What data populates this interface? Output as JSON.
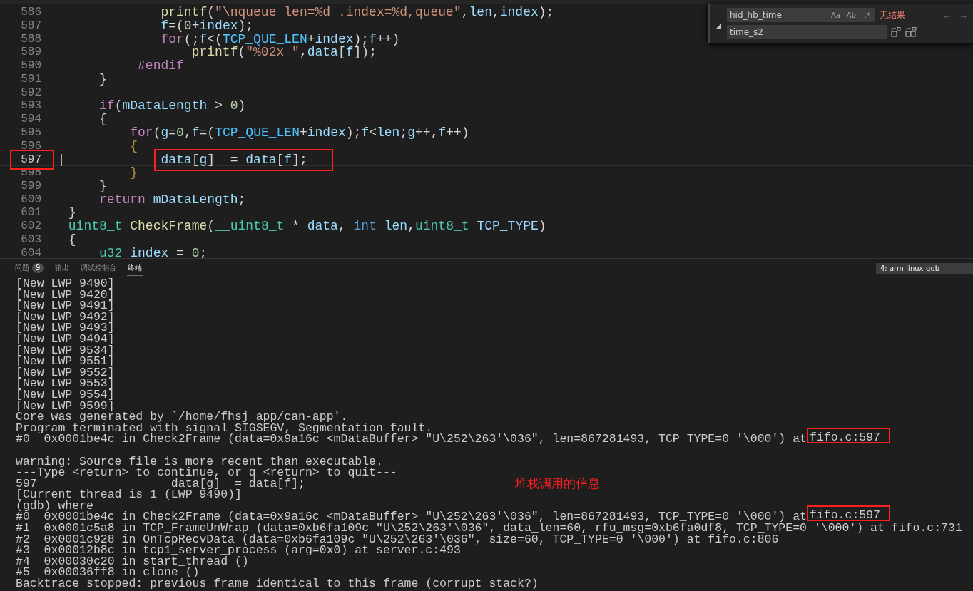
{
  "editor": {
    "lines": [
      {
        "number": "586",
        "tokens": [
          {
            "kind": "function",
            "text": "            printf"
          },
          {
            "kind": "plain",
            "text": "("
          },
          {
            "kind": "string",
            "text": "\"\\nqueue len=%d .index=%d,queue\""
          },
          {
            "kind": "plain",
            "text": ","
          },
          {
            "kind": "variable",
            "text": "len"
          },
          {
            "kind": "plain",
            "text": ","
          },
          {
            "kind": "variable",
            "text": "index"
          },
          {
            "kind": "plain",
            "text": ");"
          }
        ]
      },
      {
        "number": "587",
        "tokens": [
          {
            "kind": "variable",
            "text": "            f"
          },
          {
            "kind": "plain",
            "text": "=("
          },
          {
            "kind": "number",
            "text": "0"
          },
          {
            "kind": "plain",
            "text": "+"
          },
          {
            "kind": "variable",
            "text": "index"
          },
          {
            "kind": "plain",
            "text": ");"
          }
        ]
      },
      {
        "number": "588",
        "tokens": [
          {
            "kind": "keyword",
            "text": "            for"
          },
          {
            "kind": "plain",
            "text": "(;"
          },
          {
            "kind": "variable",
            "text": "f"
          },
          {
            "kind": "plain",
            "text": "<("
          },
          {
            "kind": "macro",
            "text": "TCP_QUE_LEN"
          },
          {
            "kind": "plain",
            "text": "+"
          },
          {
            "kind": "variable",
            "text": "index"
          },
          {
            "kind": "plain",
            "text": ");"
          },
          {
            "kind": "variable",
            "text": "f"
          },
          {
            "kind": "plain",
            "text": "++)"
          }
        ]
      },
      {
        "number": "589",
        "tokens": [
          {
            "kind": "function",
            "text": "                printf"
          },
          {
            "kind": "plain",
            "text": "("
          },
          {
            "kind": "string",
            "text": "\"%02x \""
          },
          {
            "kind": "plain",
            "text": ","
          },
          {
            "kind": "variable",
            "text": "data"
          },
          {
            "kind": "plain",
            "text": "["
          },
          {
            "kind": "variable",
            "text": "f"
          },
          {
            "kind": "plain",
            "text": "]);"
          }
        ]
      },
      {
        "number": "590",
        "tokens": [
          {
            "kind": "preprocessor",
            "text": "         #endif"
          }
        ]
      },
      {
        "number": "591",
        "tokens": [
          {
            "kind": "plain",
            "text": "    }"
          }
        ]
      },
      {
        "number": "592"
      },
      {
        "number": "593",
        "tokens": [
          {
            "kind": "keyword",
            "text": "    if"
          },
          {
            "kind": "plain",
            "text": "("
          },
          {
            "kind": "variable",
            "text": "mDataLength"
          },
          {
            "kind": "plain",
            "text": " > "
          },
          {
            "kind": "number",
            "text": "0"
          },
          {
            "kind": "plain",
            "text": ")"
          }
        ]
      },
      {
        "number": "594",
        "tokens": [
          {
            "kind": "plain",
            "text": "    {"
          }
        ]
      },
      {
        "number": "595",
        "tokens": [
          {
            "kind": "keyword",
            "text": "        for"
          },
          {
            "kind": "plain",
            "text": "("
          },
          {
            "kind": "variable",
            "text": "g"
          },
          {
            "kind": "plain",
            "text": "="
          },
          {
            "kind": "number",
            "text": "0"
          },
          {
            "kind": "plain",
            "text": ","
          },
          {
            "kind": "variable",
            "text": "f"
          },
          {
            "kind": "plain",
            "text": "=("
          },
          {
            "kind": "macro",
            "text": "TCP_QUE_LEN"
          },
          {
            "kind": "plain",
            "text": "+"
          },
          {
            "kind": "variable",
            "text": "index"
          },
          {
            "kind": "plain",
            "text": ");"
          },
          {
            "kind": "variable",
            "text": "f"
          },
          {
            "kind": "plain",
            "text": "<"
          },
          {
            "kind": "variable",
            "text": "len"
          },
          {
            "kind": "plain",
            "text": ";"
          },
          {
            "kind": "variable",
            "text": "g"
          },
          {
            "kind": "plain",
            "text": "++,"
          },
          {
            "kind": "variable",
            "text": "f"
          },
          {
            "kind": "plain",
            "text": "++)"
          }
        ]
      },
      {
        "number": "596",
        "tokens": [
          {
            "kind": "bracket",
            "text": "        {"
          }
        ]
      },
      {
        "number": "597",
        "current": true,
        "marked": true,
        "boxed": true,
        "tokens": [
          {
            "kind": "variable",
            "text": "            data"
          },
          {
            "kind": "plain",
            "text": "["
          },
          {
            "kind": "variable",
            "text": "g"
          },
          {
            "kind": "plain",
            "text": "]  = "
          },
          {
            "kind": "variable",
            "text": "data"
          },
          {
            "kind": "plain",
            "text": "["
          },
          {
            "kind": "variable",
            "text": "f"
          },
          {
            "kind": "plain",
            "text": "];"
          }
        ]
      },
      {
        "number": "598",
        "tokens": [
          {
            "kind": "bracket",
            "text": "        }"
          }
        ]
      },
      {
        "number": "599",
        "tokens": [
          {
            "kind": "plain",
            "text": "    }"
          }
        ]
      },
      {
        "number": "600",
        "tokens": [
          {
            "kind": "keyword",
            "text": "    return"
          },
          {
            "kind": "variable",
            "text": " mDataLength"
          },
          {
            "kind": "plain",
            "text": ";"
          }
        ]
      },
      {
        "number": "601",
        "tokens": [
          {
            "kind": "plain",
            "text": "}"
          }
        ]
      },
      {
        "number": "602",
        "tokens": [
          {
            "kind": "type",
            "text": "uint8_t"
          },
          {
            "kind": "function",
            "text": " CheckFrame"
          },
          {
            "kind": "plain",
            "text": "("
          },
          {
            "kind": "type",
            "text": "__uint8_t"
          },
          {
            "kind": "plain",
            "text": " * "
          },
          {
            "kind": "variable",
            "text": "data"
          },
          {
            "kind": "plain",
            "text": ", "
          },
          {
            "kind": "storage",
            "text": "int"
          },
          {
            "kind": "variable",
            "text": " len"
          },
          {
            "kind": "plain",
            "text": ","
          },
          {
            "kind": "type",
            "text": "uint8_t"
          },
          {
            "kind": "variable",
            "text": " TCP_TYPE"
          },
          {
            "kind": "plain",
            "text": ")"
          }
        ]
      },
      {
        "number": "603",
        "tokens": [
          {
            "kind": "plain",
            "text": "{"
          }
        ]
      },
      {
        "number": "604",
        "tokens": [
          {
            "kind": "type",
            "text": "    u32"
          },
          {
            "kind": "variable",
            "text": " index"
          },
          {
            "kind": "plain",
            "text": " = "
          },
          {
            "kind": "number",
            "text": "0"
          },
          {
            "kind": "plain",
            "text": ";"
          }
        ]
      }
    ]
  },
  "find_widget": {
    "expanded": true,
    "find": {
      "value": "hid_hb_time"
    },
    "options": [
      {
        "label": "Aa",
        "on": false
      },
      {
        "label": "Abl",
        "on": false
      },
      {
        "label": ".*",
        "on": false
      }
    ],
    "result": "无结果",
    "nav": [
      {
        "label": "←",
        "disabled": true
      },
      {
        "label": "→",
        "disabled": true
      }
    ],
    "replace": {
      "value": "time_s2"
    }
  },
  "panel": {
    "tabs": [
      {
        "label": "问题",
        "badge": "9",
        "selected": false
      },
      {
        "label": "输出",
        "selected": false
      },
      {
        "label": "调试控制台",
        "selected": false
      },
      {
        "label": "终端",
        "selected": true
      }
    ],
    "terminal_select": "4: arm-linux-gdb"
  },
  "terminal": {
    "lines": [
      {
        "kind": "text",
        "segments": [
          {
            "text": "[New LWP 9490]"
          }
        ]
      },
      {
        "kind": "text",
        "segments": [
          {
            "text": "[New LWP 9420]"
          }
        ]
      },
      {
        "kind": "text",
        "segments": [
          {
            "text": "[New LWP 9491]"
          }
        ]
      },
      {
        "kind": "text",
        "segments": [
          {
            "text": "[New LWP 9492]"
          }
        ]
      },
      {
        "kind": "text",
        "segments": [
          {
            "text": "[New LWP 9493]"
          }
        ]
      },
      {
        "kind": "text",
        "segments": [
          {
            "text": "[New LWP 9494]"
          }
        ]
      },
      {
        "kind": "text",
        "segments": [
          {
            "text": "[New LWP 9534]"
          }
        ]
      },
      {
        "kind": "text",
        "segments": [
          {
            "text": "[New LWP 9551]"
          }
        ]
      },
      {
        "kind": "text",
        "segments": [
          {
            "text": "[New LWP 9552]"
          }
        ]
      },
      {
        "kind": "text",
        "segments": [
          {
            "text": "[New LWP 9553]"
          }
        ]
      },
      {
        "kind": "text",
        "segments": [
          {
            "text": "[New LWP 9554]"
          }
        ]
      },
      {
        "kind": "text",
        "segments": [
          {
            "text": "[New LWP 9599]"
          }
        ]
      },
      {
        "kind": "text",
        "segments": [
          {
            "text": "Core was generated by `/home/fhsj_app/can-app'."
          }
        ]
      },
      {
        "kind": "text",
        "segments": [
          {
            "text": "Program terminated with signal SIGSEGV, Segmentation fault."
          }
        ]
      },
      {
        "kind": "text",
        "segments": [
          {
            "text": "#0  0x0001be4c in Check2Frame (data=0x9a16c <mDataBuffer> \"U\\252\\263'\\036\", len=867281493, TCP_TYPE=0 '\\000') at"
          },
          {
            "text": "fifo.c:597",
            "boxed": true
          }
        ]
      },
      {
        "kind": "blank"
      },
      {
        "kind": "text",
        "segments": [
          {
            "text": "warning: Source file is more recent than executable."
          }
        ]
      },
      {
        "kind": "text",
        "segments": [
          {
            "text": "---Type <return> to continue, or q <return> to quit---"
          }
        ]
      },
      {
        "kind": "text",
        "segments": [
          {
            "text": "597\t\t      data[g]  = data[f];"
          }
        ]
      },
      {
        "kind": "text",
        "segments": [
          {
            "text": "[Current thread is 1 (LWP 9490)]"
          }
        ]
      },
      {
        "kind": "text",
        "segments": [
          {
            "text": "(gdb) where"
          }
        ]
      },
      {
        "kind": "text",
        "segments": [
          {
            "text": "#0  0x0001be4c in Check2Frame (data=0x9a16c <mDataBuffer> \"U\\252\\263'\\036\", len=867281493, TCP_TYPE=0 '\\000') at"
          },
          {
            "text": "fifo.c:597",
            "boxed": true
          }
        ]
      },
      {
        "kind": "text",
        "segments": [
          {
            "text": "#1  0x0001c5a8 in TCP_FrameUnWrap (data=0xb6fa109c \"U\\252\\263'\\036\", data_len=60, rfu_msg=0xb6fa0df8, TCP_TYPE=0 '\\000') at fifo.c:731"
          }
        ]
      },
      {
        "kind": "text",
        "segments": [
          {
            "text": "#2  0x0001c928 in OnTcpRecvData (data=0xb6fa109c \"U\\252\\263'\\036\", size=60, TCP_TYPE=0 '\\000') at fifo.c:806"
          }
        ]
      },
      {
        "kind": "text",
        "segments": [
          {
            "text": "#3  0x00012b8c in tcp1_server_process (arg=0x0) at server.c:493"
          }
        ]
      },
      {
        "kind": "text",
        "segments": [
          {
            "text": "#4  0x00030c20 in start_thread ()"
          }
        ]
      },
      {
        "kind": "text",
        "segments": [
          {
            "text": "#5  0x00036ff8 in clone ()"
          }
        ]
      },
      {
        "kind": "text",
        "segments": [
          {
            "text": "Backtrace stopped: previous frame identical to this frame (corrupt stack?)"
          }
        ]
      }
    ]
  },
  "annotation": "堆栈调用的信息"
}
